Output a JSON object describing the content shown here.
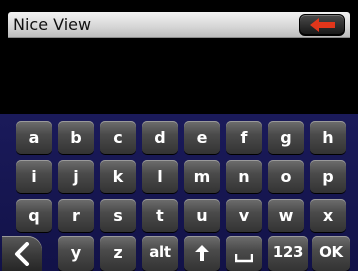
{
  "header": {
    "title": "Nice View",
    "back_icon": "left-arrow-icon",
    "back_icon_color": "#e2361b"
  },
  "display": {
    "text": ""
  },
  "keyboard": {
    "row1": [
      "a",
      "b",
      "c",
      "d",
      "e",
      "f",
      "g",
      "h"
    ],
    "row2": [
      "i",
      "j",
      "k",
      "l",
      "m",
      "n",
      "o",
      "p"
    ],
    "row3": [
      "q",
      "r",
      "s",
      "t",
      "u",
      "v",
      "w",
      "x"
    ],
    "row4": {
      "back_icon": "chevron-left-icon",
      "y": "y",
      "z": "z",
      "alt": "alt",
      "shift_icon": "up-arrow-icon",
      "space_icon": "space-icon",
      "numbers": "123",
      "ok": "OK"
    }
  }
}
